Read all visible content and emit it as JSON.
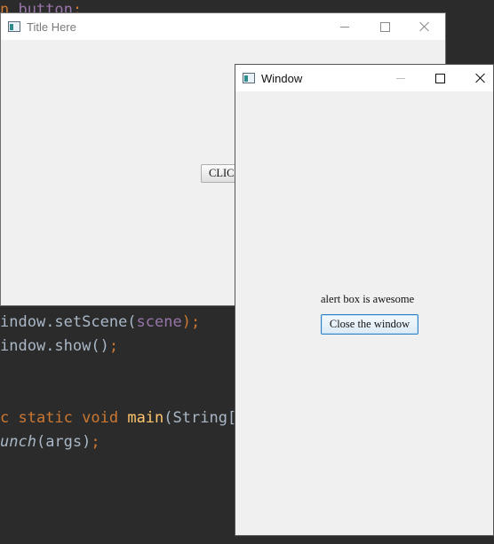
{
  "background_code": {
    "line1": {
      "a": "n ",
      "b": "button",
      "c": ";"
    },
    "line2": {
      "a": "indow",
      "b": ".setScene(",
      "c": "scene",
      "d": ");"
    },
    "line3": {
      "a": "indow",
      "b": ".show()",
      "c": ";"
    },
    "line4": {
      "a": "c ",
      "b": "static ",
      "c": "void ",
      "d": "main",
      "e": "(String[]"
    },
    "line5": {
      "a": "unch",
      "b": "(args)",
      "c": ";"
    }
  },
  "main_window": {
    "title": "Title Here",
    "button_label": "CLICK"
  },
  "popup_window": {
    "title": "Window",
    "message": "alert box is awesome",
    "close_button_label": "Close the window"
  },
  "colors": {
    "editor_background": "#2b2b2b",
    "keyword": "#cc7832",
    "method": "#ffc66d",
    "field": "#9876aa",
    "text": "#a9b7c6",
    "window_body": "#f0f0f0",
    "focus_border": "#2f80c5"
  },
  "icons": [
    "app-icon",
    "minimize-icon",
    "maximize-icon",
    "close-icon"
  ]
}
